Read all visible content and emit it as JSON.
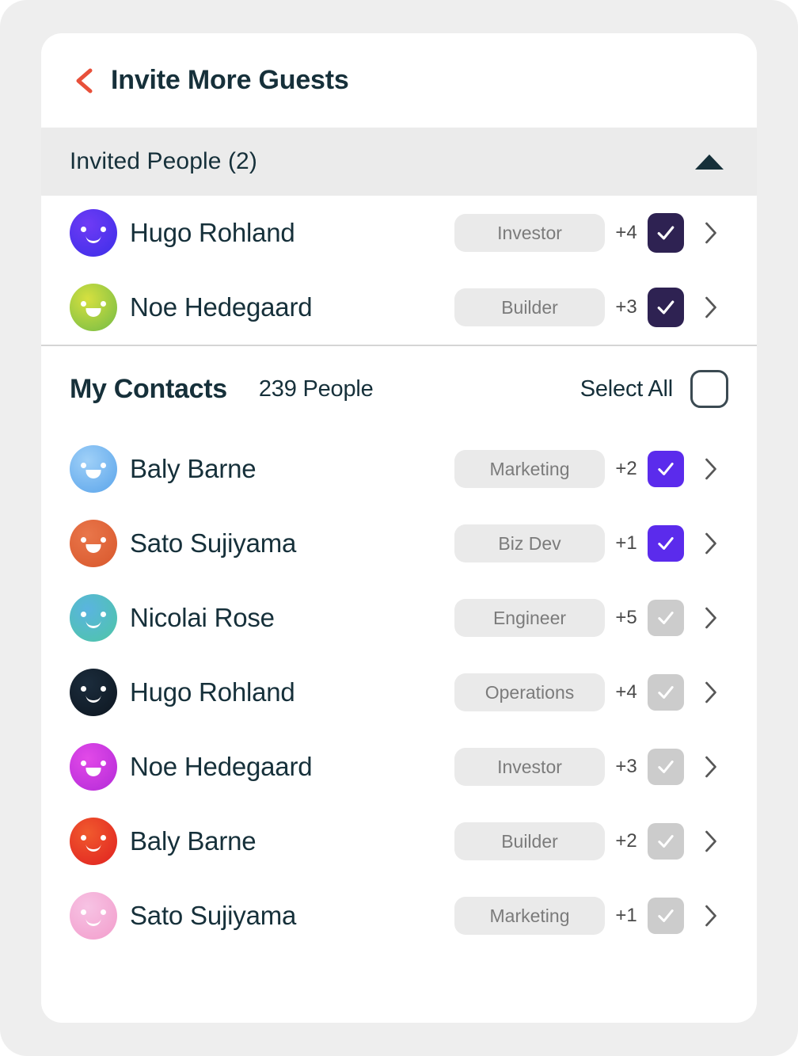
{
  "colors": {
    "page_bg": "#eeeeee",
    "card_bg": "#ffffff",
    "band_bg": "#ebebeb",
    "text_dark": "#16303a",
    "back_arrow": "#e8503a",
    "tag_bg": "#eaeaea",
    "tag_text": "#7b7b7b",
    "checkbox_invited": "#2e2252",
    "checkbox_on": "#5b2bec",
    "checkbox_off": "#cccccc",
    "divider": "#d5d5d5"
  },
  "header": {
    "title": "Invite More Guests",
    "back_icon": "chevron-left-icon"
  },
  "invited_section": {
    "title": "Invited People  (2)",
    "collapse_icon": "triangle-up-icon",
    "people": [
      {
        "name": "Hugo Rohland",
        "tag": "Investor",
        "extra": "+4",
        "checked": true,
        "avatar": {
          "from": "#6f3bf5",
          "to": "#3b2ee8",
          "mouth": "arc"
        }
      },
      {
        "name": "Noe Hedegaard",
        "tag": "Builder",
        "extra": "+3",
        "checked": true,
        "avatar": {
          "from": "#d6e03f",
          "to": "#72bb46",
          "mouth": "open"
        }
      }
    ]
  },
  "contacts_section": {
    "title": "My Contacts",
    "count_label": "239 People",
    "select_all_label": "Select All",
    "select_all_checked": false,
    "people": [
      {
        "name": "Baly Barne",
        "tag": "Marketing",
        "extra": "+2",
        "checked": true,
        "avatar": {
          "from": "#9fd0f8",
          "to": "#5aa4ea",
          "mouth": "open"
        }
      },
      {
        "name": "Sato Sujiyama",
        "tag": "Biz Dev",
        "extra": "+1",
        "checked": true,
        "avatar": {
          "from": "#e9764a",
          "to": "#d8572c",
          "mouth": "open"
        }
      },
      {
        "name": "Nicolai Rose",
        "tag": "Engineer",
        "extra": "+5",
        "checked": false,
        "avatar": {
          "from": "#5ab4e0",
          "to": "#4ec6a5",
          "mouth": "arc"
        }
      },
      {
        "name": "Hugo Rohland",
        "tag": "Operations",
        "extra": "+4",
        "checked": false,
        "avatar": {
          "from": "#1b2c3c",
          "to": "#0d1620",
          "mouth": "arc"
        }
      },
      {
        "name": "Noe Hedegaard",
        "tag": "Investor",
        "extra": "+3",
        "checked": false,
        "avatar": {
          "from": "#e24ae8",
          "to": "#b32ad8",
          "mouth": "open"
        }
      },
      {
        "name": "Baly Barne",
        "tag": "Builder",
        "extra": "+2",
        "checked": false,
        "avatar": {
          "from": "#f05a2e",
          "to": "#e02020",
          "mouth": "arc"
        }
      },
      {
        "name": "Sato Sujiyama",
        "tag": "Marketing",
        "extra": "+1",
        "checked": false,
        "avatar": {
          "from": "#f7c3e4",
          "to": "#f29ccb",
          "mouth": "arc"
        }
      }
    ]
  }
}
